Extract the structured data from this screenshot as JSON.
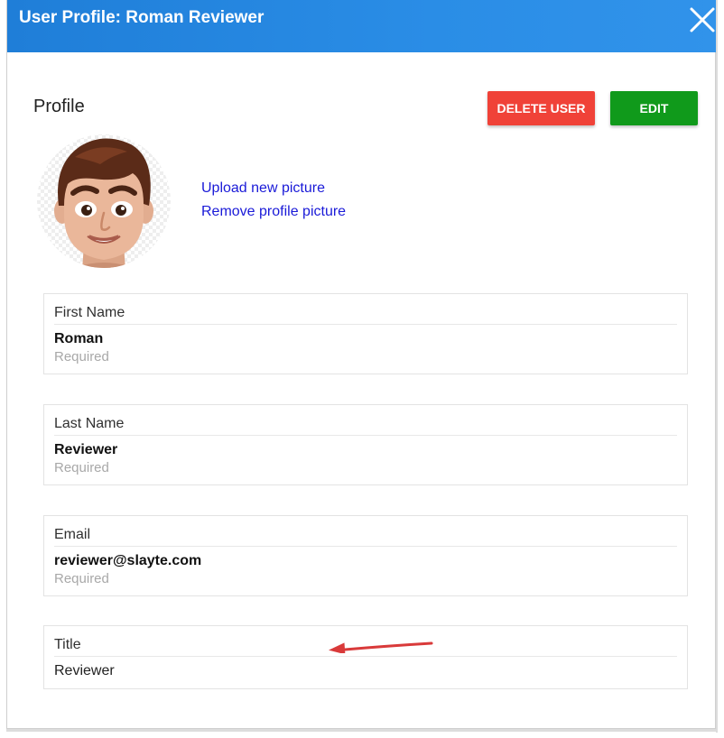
{
  "dialog": {
    "title": "User Profile: Roman Reviewer",
    "close_icon": "close-icon"
  },
  "profile": {
    "heading": "Profile",
    "delete_label": "DELETE USER",
    "edit_label": "EDIT",
    "avatar_icon": "cartoon-man-avatar",
    "upload_label": "Upload new picture",
    "remove_label": "Remove profile picture"
  },
  "fields": {
    "first_name": {
      "label": "First Name",
      "value": "Roman",
      "hint": "Required"
    },
    "last_name": {
      "label": "Last Name",
      "value": "Reviewer",
      "hint": "Required"
    },
    "email": {
      "label": "Email",
      "value": "reviewer@slayte.com",
      "hint": "Required"
    },
    "title": {
      "label": "Title",
      "value": "Reviewer"
    }
  },
  "annotation": {
    "arrow_icon": "red-arrow-left-icon"
  },
  "colors": {
    "header": "#2a8de6",
    "delete": "#f04238",
    "edit": "#109a1b",
    "link": "#1a1ad8",
    "arrow": "#d93a3a"
  }
}
